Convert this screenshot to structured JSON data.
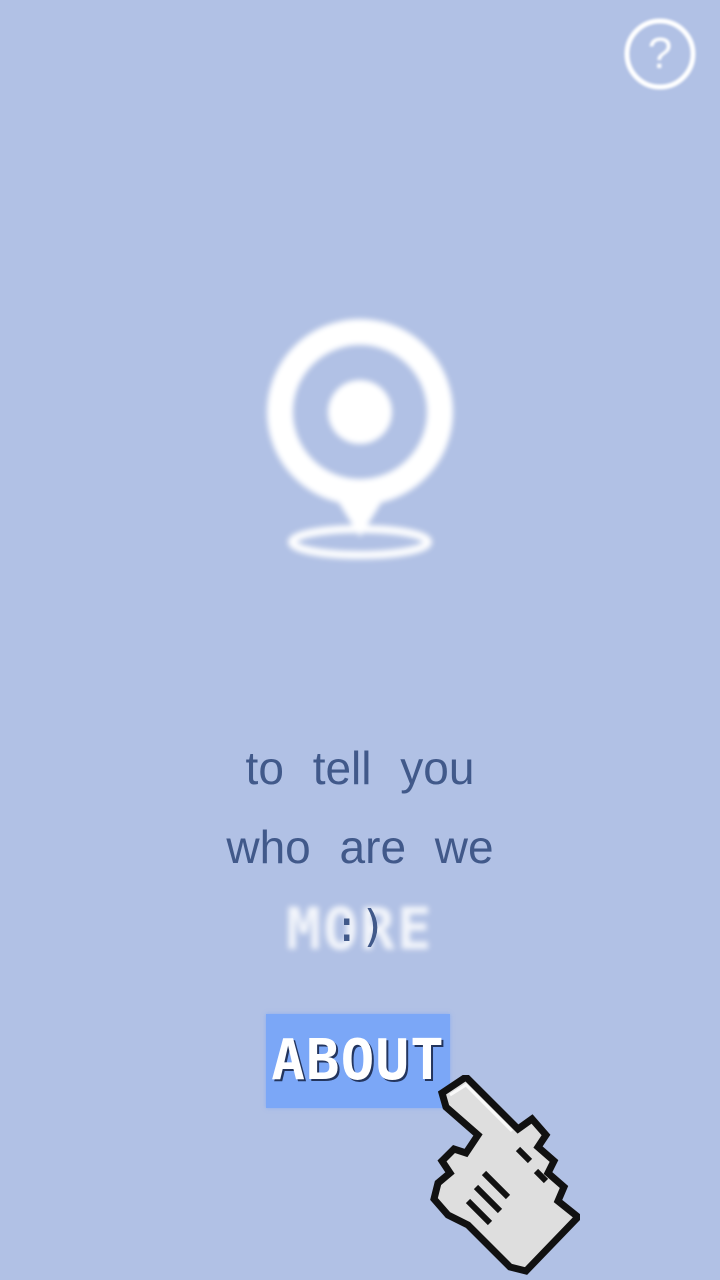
{
  "header": {
    "help_icon": "help-circle-icon",
    "help_glyph": "?"
  },
  "hero": {
    "icon": "location-pin-icon"
  },
  "tagline": {
    "line1": "to tell you",
    "line2": "who are we",
    "line3": ":)"
  },
  "background_text": {
    "label": "MORE"
  },
  "about_button": {
    "label": "ABOUT"
  },
  "cursor": {
    "icon": "pointing-hand-cursor-icon"
  },
  "colors": {
    "background": "#b1c1e5",
    "text": "#41598a",
    "button": "#7ba7f7",
    "icon": "#ffffff"
  }
}
